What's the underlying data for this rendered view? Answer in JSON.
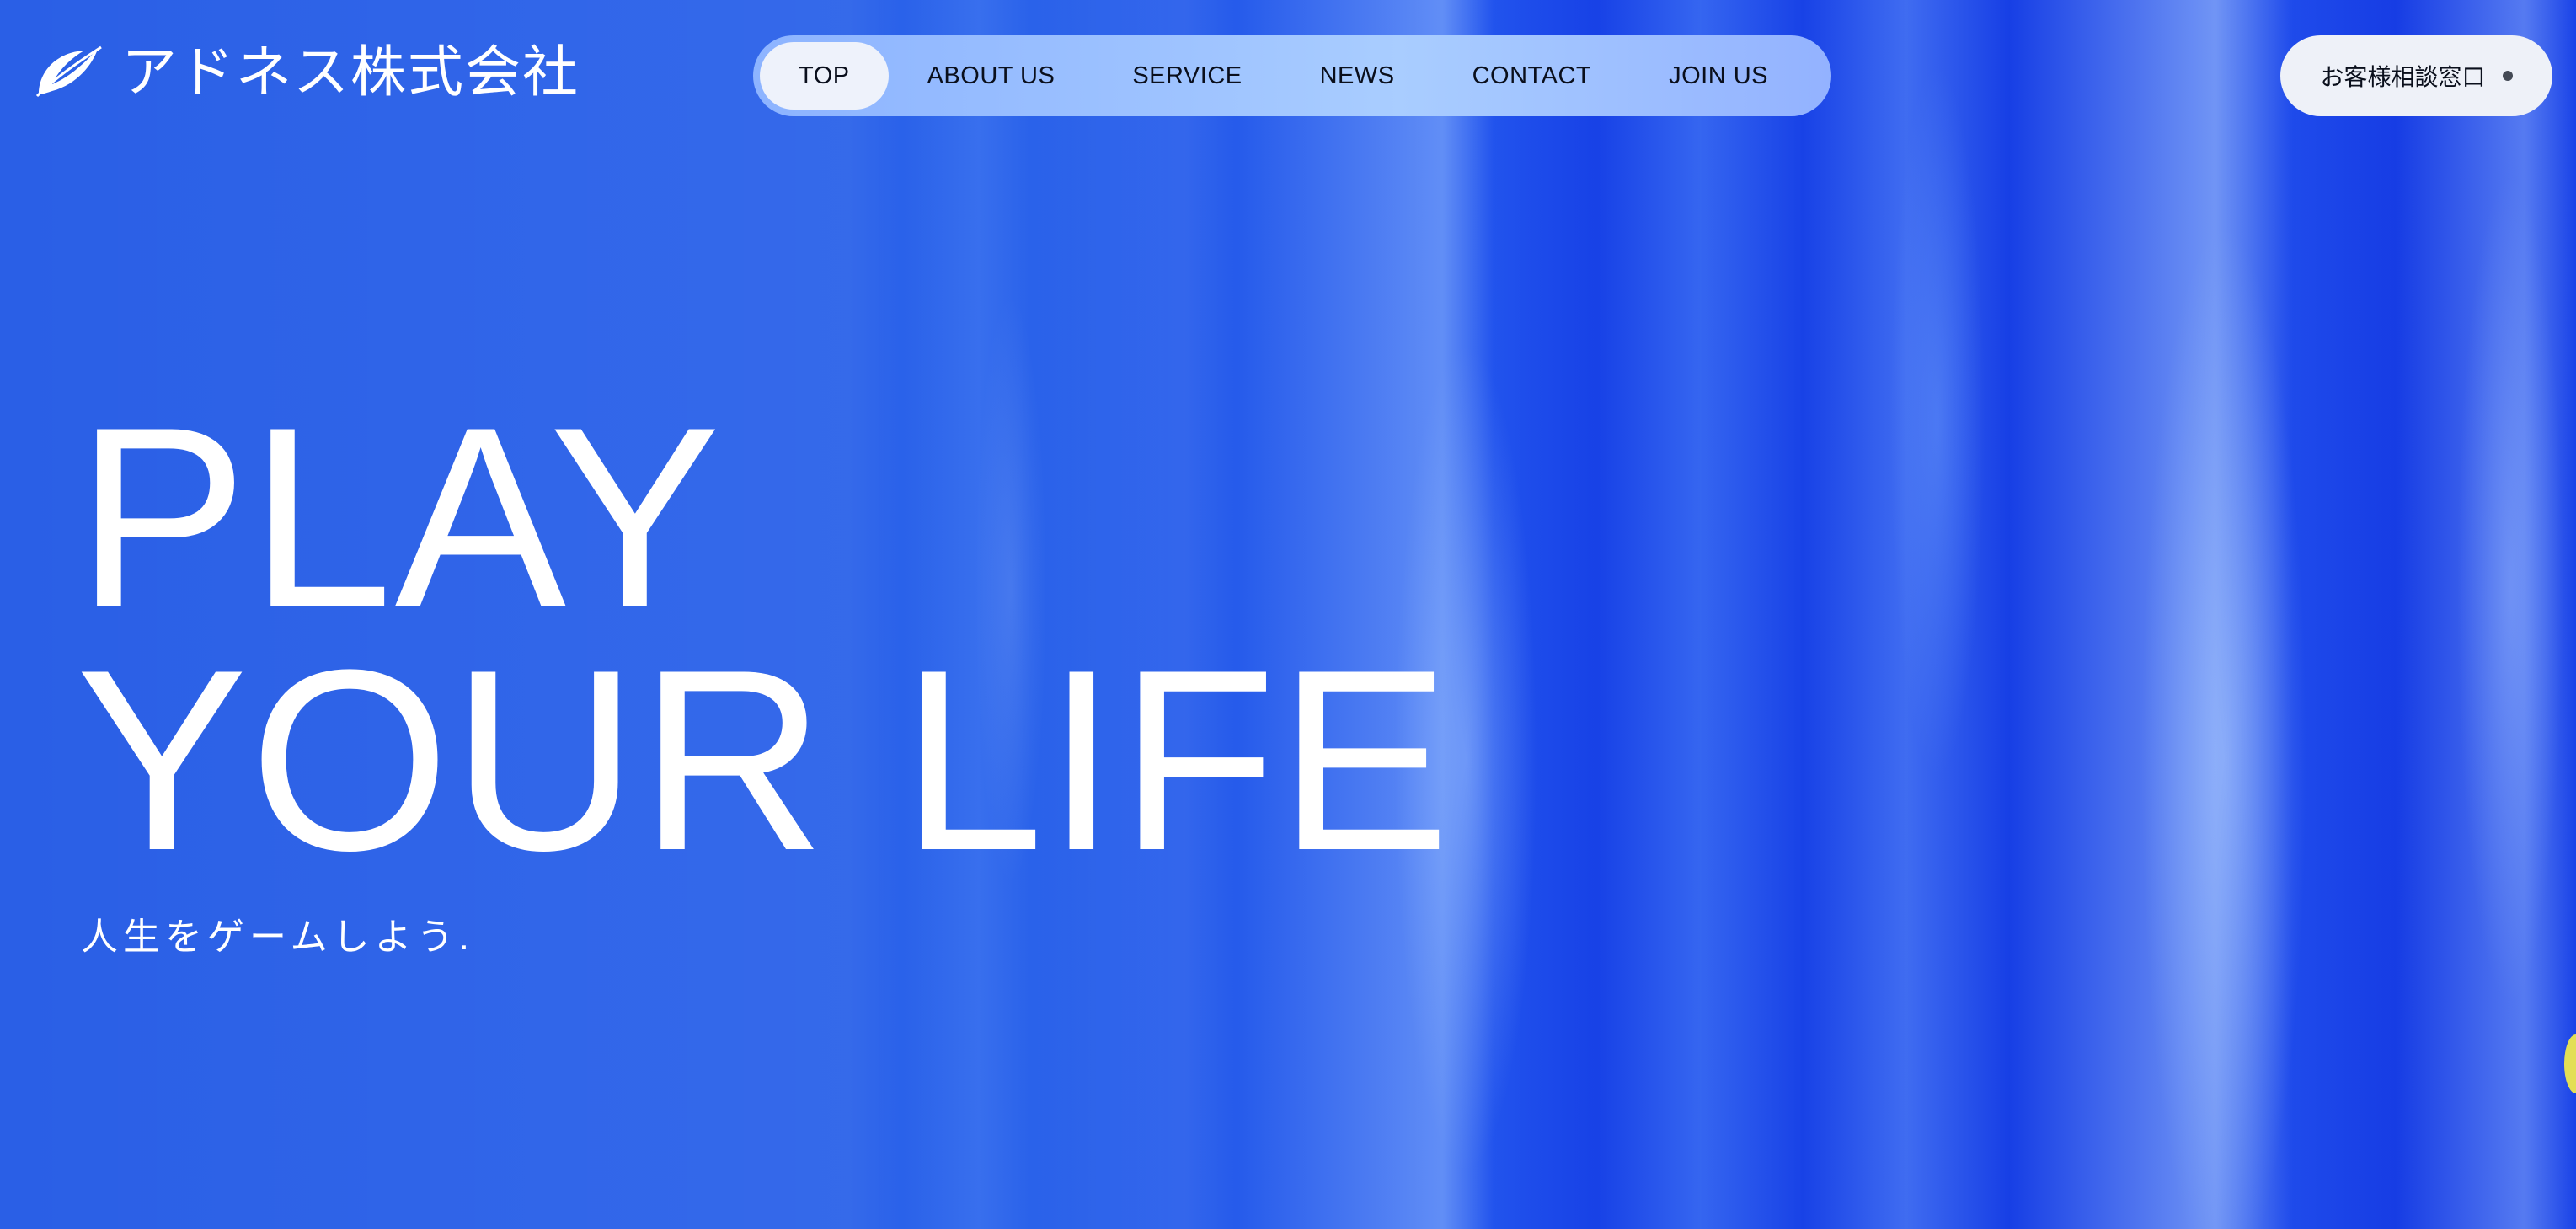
{
  "header": {
    "logo_text": "アドネス株式会社",
    "logo_icon": "leaf-swoosh-icon"
  },
  "nav": {
    "items": [
      {
        "label": "TOP",
        "active": true
      },
      {
        "label": "ABOUT US",
        "active": false
      },
      {
        "label": "SERVICE",
        "active": false
      },
      {
        "label": "NEWS",
        "active": false
      },
      {
        "label": "CONTACT",
        "active": false
      },
      {
        "label": "JOIN US",
        "active": false
      }
    ]
  },
  "consult_button": {
    "label": "お客様相談窓口",
    "icon": "dot-icon"
  },
  "hero": {
    "line1": "PLAY",
    "line2": "YOUR LIFE",
    "subline": "人生をゲームしよう."
  },
  "colors": {
    "background": "#2a5fe6",
    "nav_bg": "#9ec3ff",
    "active_pill": "#eef2fb",
    "text_light": "#ffffff",
    "text_dark": "#0a0f1c"
  }
}
